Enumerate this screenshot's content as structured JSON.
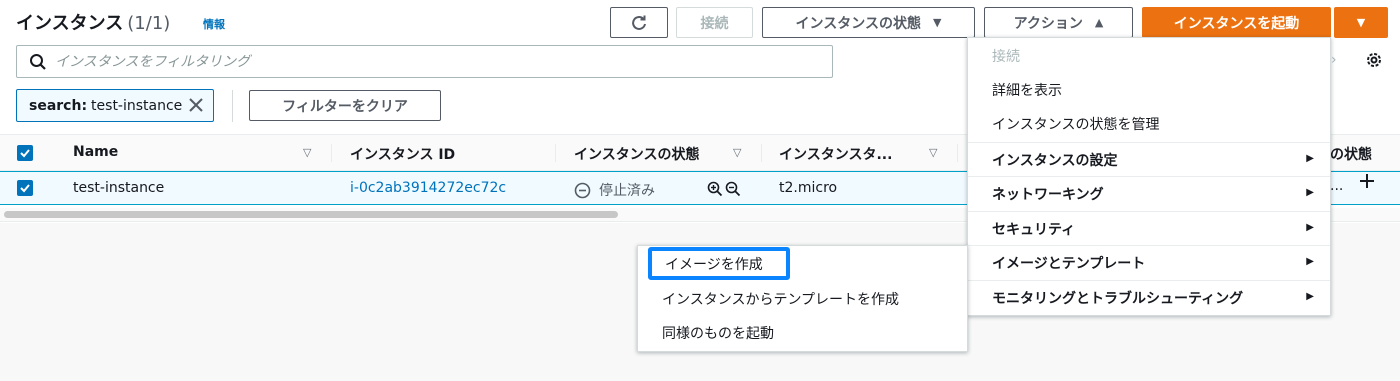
{
  "header": {
    "title": "インスタンス",
    "count": "(1/1)",
    "info_link": "情報"
  },
  "toolbar": {
    "connect_label": "接続",
    "instance_state_label": "インスタンスの状態",
    "actions_label": "アクション",
    "launch_label": "インスタンスを起動"
  },
  "search": {
    "placeholder": "インスタンスをフィルタリング",
    "value": ""
  },
  "filter_token": {
    "key": "search:",
    "value": "test-instance"
  },
  "clear_filters_label": "フィルターをクリア",
  "table": {
    "columns": [
      "Name",
      "インスタンス ID",
      "インスタンスの状態",
      "インスタンスタ...",
      "の状態"
    ],
    "rows": [
      {
        "name": "test-instance",
        "instance_id": "i-0c2ab3914272ec72c",
        "state": "停止済み",
        "instance_type": "t2.micro",
        "status_check": "..."
      }
    ]
  },
  "actions_menu": {
    "items": [
      {
        "label": "接続",
        "disabled": true
      },
      {
        "label": "詳細を表示"
      },
      {
        "label": "インスタンスの状態を管理"
      },
      {
        "label": "インスタンスの設定",
        "submenu": true
      },
      {
        "label": "ネットワーキング",
        "submenu": true
      },
      {
        "label": "セキュリティ",
        "submenu": true
      },
      {
        "label": "イメージとテンプレート",
        "submenu": true
      },
      {
        "label": "モニタリングとトラブルシューティング",
        "submenu": true
      }
    ]
  },
  "image_submenu": {
    "items": [
      {
        "label": "イメージを作成"
      },
      {
        "label": "インスタンスからテンプレートを作成"
      },
      {
        "label": "同様のものを起動"
      }
    ]
  },
  "colors": {
    "primary_orange": "#ec7211",
    "link_blue": "#0073bb",
    "focus_blue": "#0a84ff",
    "selected_row": "#f1faff"
  }
}
